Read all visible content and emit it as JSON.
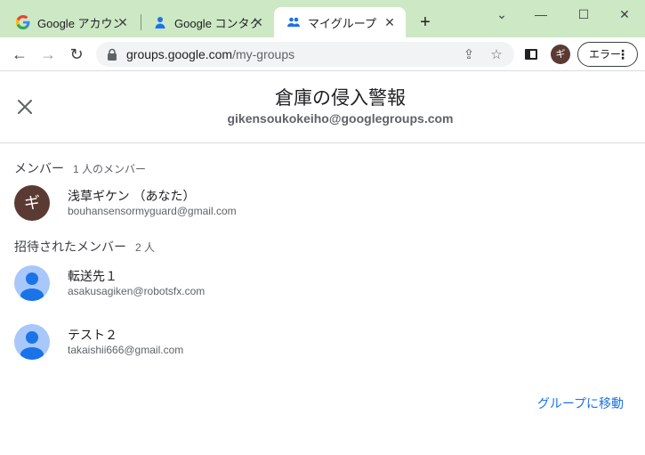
{
  "browser": {
    "tabs": [
      {
        "label": "Google アカウント",
        "icon": "google-g-icon"
      },
      {
        "label": "Google コンタクト",
        "icon": "contacts-person-icon"
      },
      {
        "label": "マイグループ",
        "icon": "groups-people-icon"
      }
    ],
    "url_host": "groups.google.com",
    "url_path": "/my-groups",
    "profile_initial": "ギ",
    "error_button": "エラー"
  },
  "dialog": {
    "group_title": "倉庫の侵入警報",
    "group_email": "gikensoukokeiho@googlegroups.com",
    "members_section": {
      "label": "メンバー",
      "count": "1 人のメンバー"
    },
    "members": [
      {
        "initial": "ギ",
        "name": "浅草ギケン （あなた）",
        "email": "bouhansensormyguard@gmail.com"
      }
    ],
    "invited_section": {
      "label": "招待されたメンバー",
      "count": "2 人"
    },
    "invited": [
      {
        "name": "転送先１",
        "email": "asakusagiken@robotsfx.com"
      },
      {
        "name": "テスト２",
        "email": "takaishii666@gmail.com"
      }
    ],
    "goto_link": "グループに移動"
  },
  "colors": {
    "accent": "#1a73e8",
    "tabstrip": "#cde8c4",
    "avatar_brown": "#5a3a32",
    "avatar_blue": "#a8c7fa"
  }
}
